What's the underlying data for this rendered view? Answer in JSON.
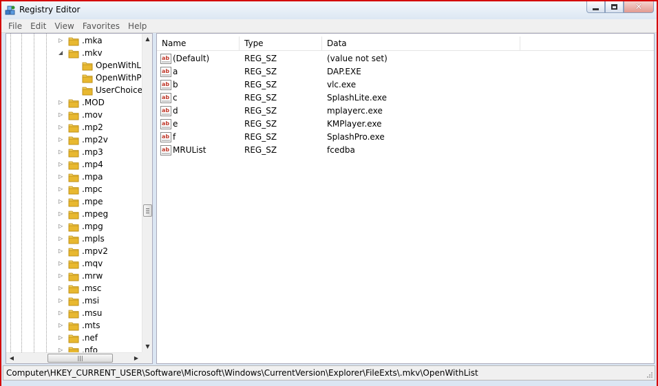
{
  "window": {
    "title": "Registry Editor"
  },
  "menu": [
    "File",
    "Edit",
    "View",
    "Favorites",
    "Help"
  ],
  "tree": {
    "items": [
      {
        "label": ".mka",
        "depth": 0,
        "expander": "collapsed"
      },
      {
        "label": ".mkv",
        "depth": 0,
        "expander": "expanded"
      },
      {
        "label": "OpenWithList",
        "depth": 1,
        "expander": "none"
      },
      {
        "label": "OpenWithProgids",
        "depth": 1,
        "expander": "none"
      },
      {
        "label": "UserChoice",
        "depth": 1,
        "expander": "none"
      },
      {
        "label": ".MOD",
        "depth": 0,
        "expander": "collapsed"
      },
      {
        "label": ".mov",
        "depth": 0,
        "expander": "collapsed"
      },
      {
        "label": ".mp2",
        "depth": 0,
        "expander": "collapsed"
      },
      {
        "label": ".mp2v",
        "depth": 0,
        "expander": "collapsed"
      },
      {
        "label": ".mp3",
        "depth": 0,
        "expander": "collapsed"
      },
      {
        "label": ".mp4",
        "depth": 0,
        "expander": "collapsed"
      },
      {
        "label": ".mpa",
        "depth": 0,
        "expander": "collapsed"
      },
      {
        "label": ".mpc",
        "depth": 0,
        "expander": "collapsed"
      },
      {
        "label": ".mpe",
        "depth": 0,
        "expander": "collapsed"
      },
      {
        "label": ".mpeg",
        "depth": 0,
        "expander": "collapsed"
      },
      {
        "label": ".mpg",
        "depth": 0,
        "expander": "collapsed"
      },
      {
        "label": ".mpls",
        "depth": 0,
        "expander": "collapsed"
      },
      {
        "label": ".mpv2",
        "depth": 0,
        "expander": "collapsed"
      },
      {
        "label": ".mqv",
        "depth": 0,
        "expander": "collapsed"
      },
      {
        "label": ".mrw",
        "depth": 0,
        "expander": "collapsed"
      },
      {
        "label": ".msc",
        "depth": 0,
        "expander": "collapsed"
      },
      {
        "label": ".msi",
        "depth": 0,
        "expander": "collapsed"
      },
      {
        "label": ".msu",
        "depth": 0,
        "expander": "collapsed"
      },
      {
        "label": ".mts",
        "depth": 0,
        "expander": "collapsed"
      },
      {
        "label": ".nef",
        "depth": 0,
        "expander": "collapsed"
      },
      {
        "label": ".nfo",
        "depth": 0,
        "expander": "collapsed"
      }
    ]
  },
  "list": {
    "columns": [
      "Name",
      "Type",
      "Data"
    ],
    "rows": [
      {
        "name": "(Default)",
        "type": "REG_SZ",
        "data": "(value not set)"
      },
      {
        "name": "a",
        "type": "REG_SZ",
        "data": "DAP.EXE"
      },
      {
        "name": "b",
        "type": "REG_SZ",
        "data": "vlc.exe"
      },
      {
        "name": "c",
        "type": "REG_SZ",
        "data": "SplashLite.exe"
      },
      {
        "name": "d",
        "type": "REG_SZ",
        "data": "mplayerc.exe"
      },
      {
        "name": "e",
        "type": "REG_SZ",
        "data": "KMPlayer.exe"
      },
      {
        "name": "f",
        "type": "REG_SZ",
        "data": "SplashPro.exe"
      },
      {
        "name": "MRUList",
        "type": "REG_SZ",
        "data": "fcedba"
      }
    ]
  },
  "status": {
    "path": "Computer\\HKEY_CURRENT_USER\\Software\\Microsoft\\Windows\\CurrentVersion\\Explorer\\FileExts\\.mkv\\OpenWithList"
  },
  "colors": {
    "border": "#d40000",
    "folder": "#e8b830",
    "ab_icon": "#c0392b"
  }
}
